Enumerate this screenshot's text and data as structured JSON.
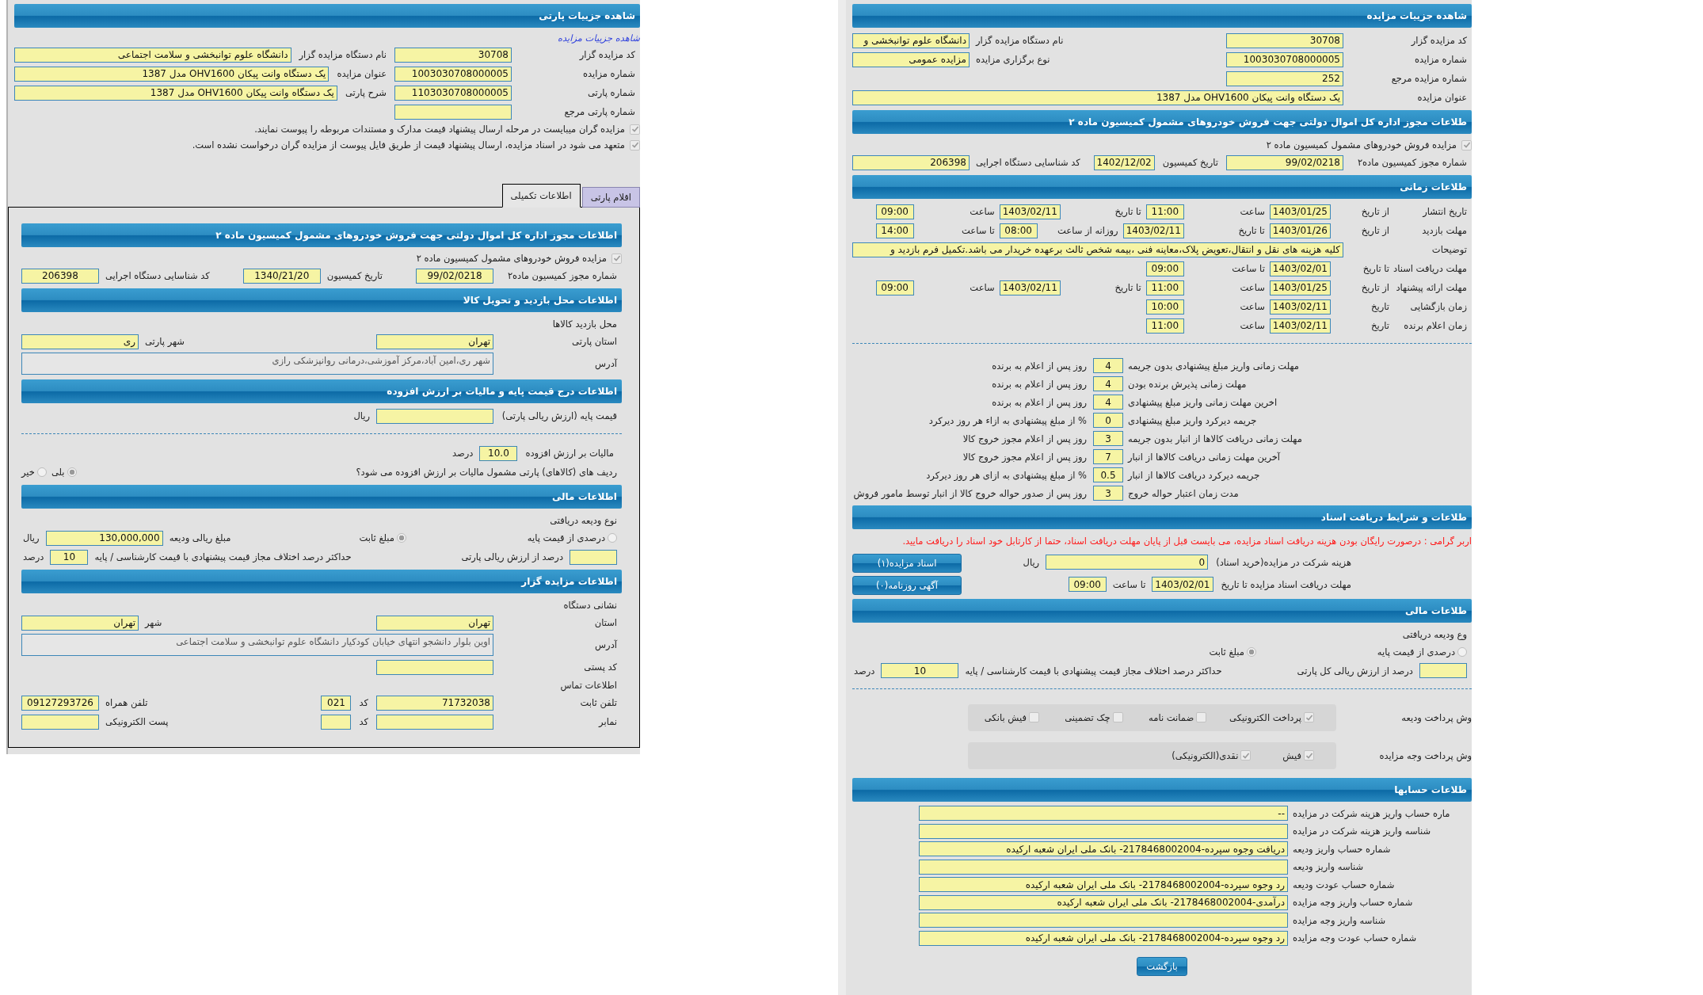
{
  "panels": [
    {
      "title": "شاهده جزییات مزایده",
      "sections": [
        {
          "kind": "form",
          "rows": [
            {
              "kind": "fields",
              "items": [
                {
                  "kind": "label",
                  "text": "کد مزایده گزار"
                },
                {
                  "kind": "field",
                  "value": "30708"
                },
                {
                  "kind": "fill",
                  "text": "نام دستگاه مزایده گزار"
                },
                {
                  "kind": "field",
                  "value": "دانشگاه علوم توانبخشی و"
                }
              ]
            },
            {
              "kind": "fields",
              "items": [
                {
                  "kind": "label",
                  "text": "شماره مزایده"
                },
                {
                  "kind": "field",
                  "value": "1003030708000005"
                },
                {
                  "kind": "fill",
                  "text": "نوع برگزاری مزایده"
                },
                {
                  "kind": "field",
                  "value": "مزایده عمومی"
                }
              ]
            },
            {
              "kind": "fields",
              "items": [
                {
                  "kind": "label",
                  "text": "شماره مزایده مرجع"
                },
                {
                  "kind": "field",
                  "value": "252"
                }
              ]
            },
            {
              "kind": "fields",
              "items": [
                {
                  "kind": "label",
                  "text": "عنوان مزایده"
                },
                {
                  "kind": "long",
                  "value": "یک دستگاه وانت پیکان OHV1600 مدل 1387"
                }
              ]
            }
          ]
        },
        {
          "kind": "form",
          "title": "طلاعات مجوز اداره کل اموال دولتی جهت فروش خودروهای مشمول کمیسیون ماده ۲",
          "rows": [
            {
              "kind": "check",
              "label": "مزایده فروش خودروهای مشمول کمیسیون ماده ۲",
              "checked": true
            },
            {
              "kind": "fields",
              "items": [
                {
                  "kind": "label",
                  "text": "شماره مجوز کمیسیون ماده۲"
                },
                {
                  "kind": "field",
                  "value": "99/02/0218"
                },
                {
                  "kind": "label2",
                  "text": "تاریخ کمیسیون"
                },
                {
                  "kind": "date",
                  "value": "1402/12/02"
                },
                {
                  "kind": "fill",
                  "text": "کد شناسایی دستگاه اجرایی"
                },
                {
                  "kind": "field",
                  "value": "206398"
                }
              ]
            }
          ]
        },
        {
          "kind": "form",
          "title": "طلاعات زمانی",
          "rows": [
            {
              "kind": "fields",
              "items": [
                {
                  "kind": "label-s",
                  "text": "تاریخ انتشار"
                },
                {
                  "kind": "sub",
                  "text": "از تاریخ"
                },
                {
                  "kind": "date",
                  "value": "1403/01/25"
                },
                {
                  "kind": "caption",
                  "text": "ساعت"
                },
                {
                  "kind": "time",
                  "value": "11:00"
                },
                {
                  "kind": "caption",
                  "text": "تا تاریخ"
                },
                {
                  "kind": "date",
                  "value": "1403/02/11"
                },
                {
                  "kind": "caption",
                  "text": "ساعت"
                },
                {
                  "kind": "time",
                  "value": "09:00"
                }
              ]
            },
            {
              "kind": "fields",
              "items": [
                {
                  "kind": "label-s",
                  "text": "مهلت بازدید"
                },
                {
                  "kind": "sub",
                  "text": "از تاریخ"
                },
                {
                  "kind": "date",
                  "value": "1403/01/26"
                },
                {
                  "kind": "caption",
                  "text": "تا تاریخ"
                },
                {
                  "kind": "date",
                  "value": "1403/02/11"
                },
                {
                  "kind": "caption",
                  "text": "روزانه از ساعت"
                },
                {
                  "kind": "time",
                  "value": "08:00"
                },
                {
                  "kind": "caption",
                  "text": "تا ساعت"
                },
                {
                  "kind": "time",
                  "value": "14:00"
                }
              ]
            },
            {
              "kind": "fields",
              "items": [
                {
                  "kind": "label",
                  "text": "توضیحات"
                },
                {
                  "kind": "long",
                  "value": "کلیه هزینه های نقل و انتقال،تعویض پلاک،معاینه فنی ،بیمه شخص ثالث برعهده خریدار می باشد.تکمیل فرم بازدید و"
                }
              ]
            },
            {
              "kind": "fields",
              "items": [
                {
                  "kind": "label-s",
                  "text": "مهلت دریافت اسناد"
                },
                {
                  "kind": "sub",
                  "text": "تا تاریخ"
                },
                {
                  "kind": "date",
                  "value": "1403/02/01"
                },
                {
                  "kind": "caption",
                  "text": "تا ساعت"
                },
                {
                  "kind": "time",
                  "value": "09:00"
                }
              ]
            },
            {
              "kind": "fields",
              "items": [
                {
                  "kind": "label-s",
                  "text": "مهلت ارائه پیشنهاد"
                },
                {
                  "kind": "sub",
                  "text": "از تاریخ"
                },
                {
                  "kind": "date",
                  "value": "1403/01/25"
                },
                {
                  "kind": "caption",
                  "text": "ساعت"
                },
                {
                  "kind": "time",
                  "value": "11:00"
                },
                {
                  "kind": "caption",
                  "text": "تا تاریخ"
                },
                {
                  "kind": "date",
                  "value": "1403/02/11"
                },
                {
                  "kind": "caption",
                  "text": "ساعت"
                },
                {
                  "kind": "time",
                  "value": "09:00"
                }
              ]
            },
            {
              "kind": "fields",
              "items": [
                {
                  "kind": "label-s",
                  "text": "زمان بازگشایی"
                },
                {
                  "kind": "sub",
                  "text": "تاریخ"
                },
                {
                  "kind": "date",
                  "value": "1403/02/11"
                },
                {
                  "kind": "caption",
                  "text": "ساعت"
                },
                {
                  "kind": "time",
                  "value": "10:00"
                }
              ]
            },
            {
              "kind": "fields",
              "items": [
                {
                  "kind": "label-s",
                  "text": "زمان اعلام برنده"
                },
                {
                  "kind": "sub",
                  "text": "تاریخ"
                },
                {
                  "kind": "date",
                  "value": "1403/02/11"
                },
                {
                  "kind": "caption",
                  "text": "ساعت"
                },
                {
                  "kind": "time",
                  "value": "11:00"
                }
              ]
            },
            {
              "kind": "divider"
            }
          ]
        },
        {
          "kind": "terms",
          "rows": [
            {
              "kind": "fields",
              "items": [
                {
                  "kind": "term",
                  "text": "مهلت زمانی واریز مبلغ پیشنهادی بدون جریمه"
                },
                {
                  "kind": "num",
                  "value": "4"
                },
                {
                  "kind": "text",
                  "text": "روز پس از اعلام به برنده"
                }
              ]
            },
            {
              "kind": "fields",
              "items": [
                {
                  "kind": "term",
                  "text": "مهلت زمانی پذیرش برنده بودن"
                },
                {
                  "kind": "num",
                  "value": "4"
                },
                {
                  "kind": "text",
                  "text": "روز پس از اعلام به برنده"
                }
              ]
            },
            {
              "kind": "fields",
              "items": [
                {
                  "kind": "term",
                  "text": "اخرین مهلت زمانی واریز مبلغ پیشنهادی"
                },
                {
                  "kind": "num",
                  "value": "4"
                },
                {
                  "kind": "text",
                  "text": "روز پس از اعلام به برنده"
                }
              ]
            },
            {
              "kind": "fields",
              "items": [
                {
                  "kind": "term",
                  "text": "جریمه دیرکرد واریز مبلغ پیشنهادی"
                },
                {
                  "kind": "num",
                  "value": "0"
                },
                {
                  "kind": "text",
                  "text": "% از مبلغ پیشنهادی به ازاء هر روز دیرکرد"
                }
              ]
            },
            {
              "kind": "fields",
              "items": [
                {
                  "kind": "term",
                  "text": "مهلت زمانی دریافت کالاها از انبار بدون جریمه"
                },
                {
                  "kind": "num",
                  "value": "3"
                },
                {
                  "kind": "text",
                  "text": "روز پس از اعلام مجوز خروج کالا"
                }
              ]
            },
            {
              "kind": "fields",
              "items": [
                {
                  "kind": "term",
                  "text": "آخرین مهلت زمانی دریافت کالاها از انبار"
                },
                {
                  "kind": "num",
                  "value": "7"
                },
                {
                  "kind": "text",
                  "text": "روز پس از اعلام مجوز خروج کالا"
                }
              ]
            },
            {
              "kind": "fields",
              "items": [
                {
                  "kind": "term",
                  "text": "جریمه دیرکرد دریافت کالاها از انبار"
                },
                {
                  "kind": "num",
                  "value": "0.5"
                },
                {
                  "kind": "text",
                  "text": "% از مبلغ پیشنهادی به ازای هر روز دیرکرد"
                }
              ]
            },
            {
              "kind": "fields",
              "items": [
                {
                  "kind": "term",
                  "text": "مدت زمان اعتبار حواله خروج"
                },
                {
                  "kind": "num",
                  "value": "3"
                },
                {
                  "kind": "text",
                  "text": "روز پس از صدور حواله خروج کالا از انبار توسط مامور فروش"
                }
              ]
            }
          ]
        },
        {
          "kind": "docs",
          "title": "طلاعات و شرایط دریافت اسناد",
          "rows": [
            {
              "kind": "note",
              "text": "اربر گرامی : درصورت رایگان بودن هزینه دریافت اسناد مزایده، می بایست قبل از پایان مهلت دریافت اسناد، حتما از کارتابل خود اسناد را دریافت مایید."
            },
            {
              "kind": "fields",
              "items": [
                {
                  "kind": "label2",
                  "text": "هزینه شرکت در مزایده(خرید اسناد)"
                },
                {
                  "kind": "wide",
                  "value": "0"
                },
                {
                  "kind": "text",
                  "text": "ریال"
                },
                {
                  "kind": "button",
                  "text": "اسناد مزایده(۱)"
                }
              ]
            },
            {
              "kind": "fields",
              "items": [
                {
                  "kind": "label2",
                  "text": "مهلت دریافت اسناد مزایده تا تاریخ"
                },
                {
                  "kind": "date",
                  "value": "1403/02/01"
                },
                {
                  "kind": "text",
                  "text": "تا ساعت"
                },
                {
                  "kind": "time",
                  "value": "09:00"
                },
                {
                  "kind": "button",
                  "text": "آگهی روزنامه(۰)"
                }
              ]
            }
          ]
        },
        {
          "kind": "form",
          "title": "طلاعات مالی",
          "rows": [
            {
              "kind": "text",
              "text": "وع ودیعه دریافتی"
            },
            {
              "kind": "fields",
              "items": [
                {
                  "kind": "radio",
                  "label": "درصدی از قیمت پایه",
                  "selected": false
                },
                {
                  "kind": "choice",
                  "label": "مبلغ ثابت",
                  "selected": true
                }
              ]
            },
            {
              "kind": "fields",
              "items": [
                {
                  "kind": "small"
                },
                {
                  "kind": "text",
                  "text": "درصد از ارزش ریالی کل پارتی"
                },
                {
                  "kind": "fill",
                  "text": "حداکثر درصد اختلاف مجاز قیمت پیشنهادی با قیمت کارشناسی / پایه"
                },
                {
                  "kind": "mid",
                  "value": "10"
                },
                {
                  "kind": "text",
                  "text": "درصد"
                }
              ]
            },
            {
              "kind": "divider"
            },
            {
              "kind": "options",
              "label": "وش پرداخت ودیعه",
              "options": [
                {
                  "label": "پرداخت الکترونیکی",
                  "checked": true
                },
                {
                  "label": "ضمانت نامه",
                  "checked": false
                },
                {
                  "label": "چک تضمینی",
                  "checked": false
                },
                {
                  "label": "فیش بانکی",
                  "checked": false
                }
              ]
            },
            {
              "kind": "options",
              "label": "وش پرداخت وجه مزایده",
              "options": [
                {
                  "label": "فیش",
                  "checked": true
                },
                {
                  "label": "نقدی(الکترونیکی)",
                  "checked": true
                }
              ]
            }
          ]
        },
        {
          "kind": "accounts",
          "title": "طلاعات حسابها",
          "rows": [
            {
              "kind": "fields",
              "items": [
                {
                  "kind": "account",
                  "text": "ماره حساب واریز هزینه شرکت در مزایده"
                },
                {
                  "kind": "long",
                  "value": "--"
                }
              ]
            },
            {
              "kind": "fields",
              "items": [
                {
                  "kind": "account",
                  "text": "شناسه واریز هزینه شرکت در مزایده"
                },
                {
                  "kind": "long"
                }
              ]
            },
            {
              "kind": "fields",
              "items": [
                {
                  "kind": "account",
                  "text": "شماره حساب واریز ودیعه"
                },
                {
                  "kind": "long",
                  "value": "دریافت وجوه سپرده-2178468002004- بانک ملی ایران شعبه ارکیده"
                }
              ]
            },
            {
              "kind": "fields",
              "items": [
                {
                  "kind": "account",
                  "text": "شناسه واریز ودیعه"
                },
                {
                  "kind": "long"
                }
              ]
            },
            {
              "kind": "fields",
              "items": [
                {
                  "kind": "account",
                  "text": "شماره حساب عودت ودیعه"
                },
                {
                  "kind": "long",
                  "value": "رد وجوه سپرده-2178468002004- بانک ملی ایران شعبه ارکیده"
                }
              ]
            },
            {
              "kind": "fields",
              "items": [
                {
                  "kind": "account",
                  "text": "شماره حساب واریز وجه مزایده"
                },
                {
                  "kind": "long",
                  "value": "درآمدی-2178468002004- بانک ملی ایران شعبه ارکیده"
                }
              ]
            },
            {
              "kind": "fields",
              "items": [
                {
                  "kind": "account",
                  "text": "شناسه واریز وجه مزایده"
                },
                {
                  "kind": "long"
                }
              ]
            },
            {
              "kind": "fields",
              "items": [
                {
                  "kind": "account",
                  "text": "شماره حساب عودت وجه مزایده"
                },
                {
                  "kind": "long",
                  "value": "رد وجوه سپرده-2178468002004- بانک ملی ایران شعبه ارکیده"
                }
              ]
            }
          ]
        }
      ],
      "back_button": "بازگشت"
    },
    {
      "title": "شاهده جزییات پارتی",
      "link": "شاهده جزییات مزایده",
      "sections": [
        {
          "kind": "form",
          "rows": [
            {
              "kind": "fields",
              "items": [
                {
                  "kind": "label",
                  "text": "کد مزایده گزار"
                },
                {
                  "kind": "field",
                  "value": "30708"
                },
                {
                  "kind": "label2",
                  "text": "نام دستگاه مزایده گزار"
                },
                {
                  "kind": "long",
                  "value": "دانشگاه علوم توانبخشی و سلامت اجتماعی"
                }
              ]
            },
            {
              "kind": "fields",
              "items": [
                {
                  "kind": "label",
                  "text": "شماره مزایده"
                },
                {
                  "kind": "field",
                  "value": "1003030708000005"
                },
                {
                  "kind": "label2",
                  "text": "عنوان مزایده"
                },
                {
                  "kind": "long",
                  "value": "یک دستگاه وانت پیکان OHV1600 مدل 1387"
                }
              ]
            },
            {
              "kind": "fields",
              "items": [
                {
                  "kind": "label",
                  "text": "شماره پارتی"
                },
                {
                  "kind": "field",
                  "value": "1103030708000005"
                },
                {
                  "kind": "label2",
                  "text": "شرح پارتی"
                },
                {
                  "kind": "long",
                  "value": "یک دستگاه وانت پیکان OHV1600 مدل 1387"
                }
              ]
            },
            {
              "kind": "fields",
              "items": [
                {
                  "kind": "label",
                  "text": "شماره پارتی مرجع"
                },
                {
                  "kind": "field"
                }
              ]
            },
            {
              "kind": "check",
              "label": "مزایده گران میبایست در مرحله ارسال پیشنهاد قیمت مدارک و مستندات مربوطه را پیوست نمایند.",
              "checked": true
            },
            {
              "kind": "check",
              "label": "متعهد می شود در اسناد مزایده، ارسال پیشنهاد قیمت از طریق فایل پیوست از مزایده گران درخواست نشده است.",
              "checked": true
            }
          ]
        }
      ],
      "tabs": [
        {
          "label": "اقلام پارتی",
          "selected": false
        },
        {
          "label": "اطلاعات تکمیلی",
          "selected": true
        }
      ],
      "tab_sections": [
        {
          "kind": "form",
          "title": "اطلاعات مجوز اداره کل اموال دولتی جهت فروش خودروهای مشمول کمیسیون ماده ۲",
          "rows": [
            {
              "kind": "check",
              "label": "مزایده فروش خودروهای مشمول کمیسیون ماده ۲",
              "checked": true
            },
            {
              "kind": "fields",
              "items": [
                {
                  "kind": "label",
                  "text": "شماره مجوز کمیسیون ماده۲"
                },
                {
                  "kind": "mid",
                  "value": "99/02/0218"
                },
                {
                  "kind": "fill",
                  "text": "تاریخ کمیسیون"
                },
                {
                  "kind": "mid",
                  "value": "1340/21/20"
                },
                {
                  "kind": "fill",
                  "text": "کد شناسایی دستگاه اجرایی"
                },
                {
                  "kind": "mid",
                  "value": "206398"
                }
              ]
            }
          ]
        },
        {
          "kind": "form",
          "title": "اطلاعات محل بازدید و تحویل کالا",
          "rows": [
            {
              "kind": "text",
              "text": "محل بازدید کالاها"
            },
            {
              "kind": "fields",
              "items": [
                {
                  "kind": "label",
                  "text": "استان پارتی"
                },
                {
                  "kind": "field",
                  "value": "تهران"
                },
                {
                  "kind": "fill",
                  "text": "شهر پارتی"
                },
                {
                  "kind": "field",
                  "value": "ری"
                }
              ]
            },
            {
              "kind": "fields",
              "items": [
                {
                  "kind": "label",
                  "text": "آدرس"
                },
                {
                  "kind": "area",
                  "value": "شهر ری،امین آباد،مرکز آموزشی،درمانی روانپزشکی رازی"
                }
              ]
            }
          ]
        },
        {
          "kind": "form",
          "title": "اطلاعات درج قیمت پایه و مالیات بر ارزش افزوده",
          "rows": [
            {
              "kind": "fields",
              "items": [
                {
                  "kind": "label",
                  "text": "قیمت پایه (ارزش ریالی پارتی)"
                },
                {
                  "kind": "field"
                },
                {
                  "kind": "text",
                  "text": "ریال"
                }
              ]
            },
            {
              "kind": "divider"
            },
            {
              "kind": "fields",
              "items": [
                {
                  "kind": "label2",
                  "text": "مالیات بر ارزش افزوده"
                },
                {
                  "kind": "time",
                  "value": "10.0"
                },
                {
                  "kind": "text",
                  "text": "درصد"
                }
              ]
            },
            {
              "kind": "fields",
              "items": [
                {
                  "kind": "question",
                  "text": "ردیف های (کالاهای) پارتی مشمول مالیات بر ارزش افزوده می شود؟"
                },
                {
                  "kind": "choice",
                  "label": "بلی",
                  "selected": true
                },
                {
                  "kind": "choice",
                  "label": "خیر",
                  "selected": false
                }
              ]
            }
          ]
        },
        {
          "kind": "form",
          "title": "اطلاعات مالی",
          "rows": [
            {
              "kind": "text",
              "text": "نوع ودیعه دریافتی"
            },
            {
              "kind": "fields",
              "items": [
                {
                  "kind": "radio",
                  "label": "درصدی از قیمت پایه",
                  "selected": false
                },
                {
                  "kind": "choice",
                  "label": "مبلغ ثابت",
                  "selected": true
                },
                {
                  "kind": "fill",
                  "text": "مبلغ ریالی ودیعه"
                },
                {
                  "kind": "field",
                  "value": "130,000,000"
                },
                {
                  "kind": "text",
                  "text": "ریال"
                }
              ]
            },
            {
              "kind": "fields",
              "items": [
                {
                  "kind": "small"
                },
                {
                  "kind": "text",
                  "text": "درصد از ارزش ریالی پارتی"
                },
                {
                  "kind": "fill",
                  "text": "حداکثر درصد اختلاف مجاز قیمت پیشنهادی با قیمت کارشناسی / پایه"
                },
                {
                  "kind": "time",
                  "value": "10"
                },
                {
                  "kind": "text",
                  "text": "درصد"
                }
              ]
            }
          ]
        },
        {
          "kind": "form",
          "title": "اطلاعات مزایده گزار",
          "rows": [
            {
              "kind": "text",
              "text": "نشانی دستگاه"
            },
            {
              "kind": "fields",
              "items": [
                {
                  "kind": "label",
                  "text": "استان"
                },
                {
                  "kind": "field",
                  "value": "تهران"
                },
                {
                  "kind": "fill",
                  "text": "شهر"
                },
                {
                  "kind": "field",
                  "value": "تهران"
                }
              ]
            },
            {
              "kind": "fields",
              "items": [
                {
                  "kind": "label",
                  "text": "آدرس"
                },
                {
                  "kind": "area",
                  "value": "اوین بلوار دانشجو انتهای خیابان کودکیار دانشگاه علوم توانبخشی و سلامت اجتماعی"
                }
              ]
            },
            {
              "kind": "fields",
              "items": [
                {
                  "kind": "label",
                  "text": "کد پستی"
                },
                {
                  "kind": "field"
                }
              ]
            },
            {
              "kind": "text",
              "text": "اطلاعات تماس"
            },
            {
              "kind": "fields",
              "items": [
                {
                  "kind": "label",
                  "text": "تلفن ثابت"
                },
                {
                  "kind": "field",
                  "value": "71732038"
                },
                {
                  "kind": "label2",
                  "text": "کد"
                },
                {
                  "kind": "num",
                  "value": "021"
                },
                {
                  "kind": "fill",
                  "text": "تلفن همراه"
                },
                {
                  "kind": "mid",
                  "value": "09127293726"
                }
              ]
            },
            {
              "kind": "fields",
              "items": [
                {
                  "kind": "label",
                  "text": "نمابر"
                },
                {
                  "kind": "field"
                },
                {
                  "kind": "label2",
                  "text": "کد"
                },
                {
                  "kind": "num"
                },
                {
                  "kind": "fill",
                  "text": "پست الکترونیکی"
                },
                {
                  "kind": "mid"
                }
              ]
            }
          ]
        }
      ]
    }
  ]
}
